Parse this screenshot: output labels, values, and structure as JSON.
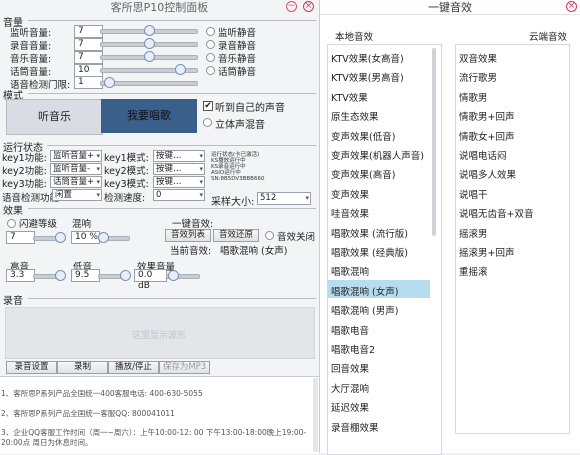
{
  "left_panel": {
    "title": "客所思P10控制面板",
    "volume": {
      "section": "音量",
      "rows": [
        {
          "label": "监听音量:",
          "value": "7",
          "knob": 0.5,
          "mute": "监听静音"
        },
        {
          "label": "录音音量:",
          "value": "7",
          "knob": 0.5,
          "mute": "录音静音"
        },
        {
          "label": "音乐音量:",
          "value": "7",
          "knob": 0.5,
          "mute": "音乐静音"
        },
        {
          "label": "话筒音量:",
          "value": "10",
          "knob": 0.85,
          "mute": "话筒静音"
        }
      ],
      "voice_threshold_label": "语音检测门限:",
      "voice_threshold_value": "1",
      "voice_threshold_knob": 0.05
    },
    "mode": {
      "section": "模式",
      "listen_music": "听音乐",
      "sing": "我要唱歌",
      "hear_self": "听到自己的声音",
      "stereo_mix": "立体声混音"
    },
    "run_status": {
      "section": "运行状态",
      "key_rows": [
        {
          "func_label": "key1功能:",
          "func_value": "监听音量+",
          "mode_label": "key1模式:",
          "mode_value": "按键…"
        },
        {
          "func_label": "key2功能:",
          "func_value": "监听音量-",
          "mode_label": "key2模式:",
          "mode_value": "按键…"
        },
        {
          "func_label": "key3功能:",
          "func_value": "话筒音量+",
          "mode_label": "key3模式:",
          "mode_value": "按键…"
        }
      ],
      "detect_label": "语音检测功能",
      "detect_value": "闲置",
      "speed_label": "检测速度:",
      "speed_value": "0",
      "status_lines": [
        "运行状态(卡已激活)",
        "KS播放运行中",
        "KS录音运行中",
        "ASIO运行中",
        "SN:8B5DV3BBB660"
      ],
      "sample_label": "采样大小:",
      "sample_value": "512"
    },
    "effects": {
      "section": "效果",
      "flash_label": "闪避等级",
      "flash_value": "7",
      "reverb_label": "混响",
      "reverb_value": "10 %",
      "one_key_label": "一键音效:",
      "effect_list_btn": "音效列表",
      "effect_restore_btn": "音效还原",
      "effect_off": "音效关闭",
      "current_label": "当前音效:",
      "current_value": "唱歌混响 (女声)",
      "treble_label": "高音",
      "treble_value": "3.3",
      "bass_label": "低音",
      "bass_value": "9.5",
      "monitor_label": "效果音量",
      "monitor_value": "0.0 dB"
    },
    "recording": {
      "section": "录音",
      "waveform_placeholder": "这里显示波形",
      "buttons": [
        "录音设置",
        "录制",
        "播放/停止",
        "保存为MP3"
      ]
    },
    "notices": [
      "1、客所思P系列产品全国统一400客服电话: 400-630-5055",
      "2、客所思P系列产品全国统一客服QQ: 800041011",
      "3、企业QQ客服工作时间（周一~周六）：上午10:00-12: 00 下午13:00-18:00晚上19:00-20:00点 周日为休息时间。"
    ]
  },
  "right_panel": {
    "title": "一键音效",
    "local_header": "本地音效",
    "cloud_header": "云端音效",
    "local_items": [
      "KTV效果(女高音)",
      "KTV效果(男高音)",
      "KTV效果",
      "原生态效果",
      "变声效果(低音)",
      "变声效果(机器人声音)",
      "变声效果(高音)",
      "变声效果",
      "哇音效果",
      "唱歌效果 (流行版)",
      "唱歌效果 (经典版)",
      "唱歌混响",
      "唱歌混响 (女声)",
      "唱歌混响 (男声)",
      "唱歌电音",
      "唱歌电音2",
      "回音效果",
      "大厅混响",
      "延迟效果",
      "录音棚效果"
    ],
    "selected_local_index": 12,
    "cloud_items": [
      "双音效果",
      "流行歌男",
      "情歌男",
      "情歌男+回声",
      "情歌女+回声",
      "说唱电话闷",
      "说唱多人效果",
      "说唱干",
      "说唱无齿音+双音",
      "摇滚男",
      "摇滚男+回声",
      "重摇滚"
    ]
  },
  "colors": {
    "accent_blue": "#3a5f8a",
    "selected_bg": "#b6dcf0",
    "close_red": "#e03060"
  }
}
